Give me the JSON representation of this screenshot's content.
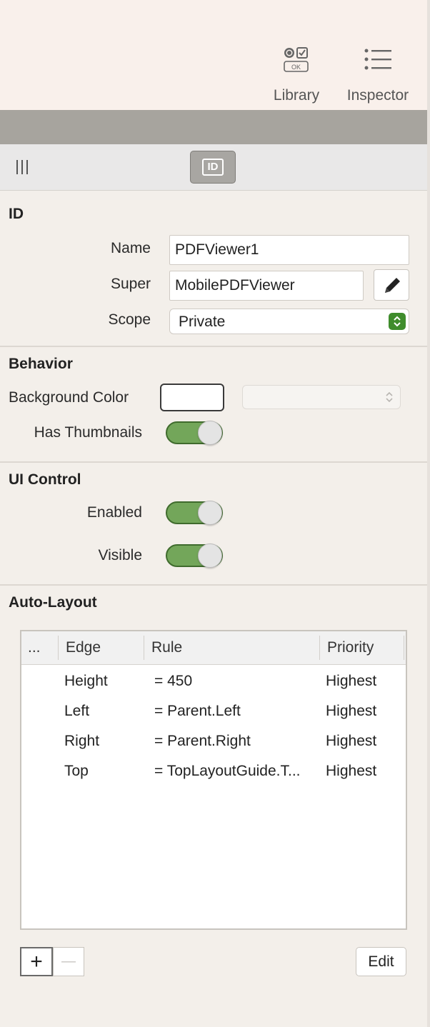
{
  "toolbar": {
    "library_label": "Library",
    "library_icon": "library-icon",
    "inspector_label": "Inspector",
    "inspector_icon": "list-icon"
  },
  "tabbar": {
    "handle_icon": "grip-icon",
    "id_tab_icon": "id-tab-icon",
    "id_tab_text": "ID"
  },
  "id_section": {
    "title": "ID",
    "name_label": "Name",
    "name_value": "PDFViewer1",
    "super_label": "Super",
    "super_value": "MobilePDFViewer",
    "scope_label": "Scope",
    "scope_value": "Private"
  },
  "behavior": {
    "title": "Behavior",
    "bg_color_label": "Background Color",
    "bg_color_value": "#ffffff",
    "thumbnails_label": "Has Thumbnails",
    "thumbnails_on": true
  },
  "ui_control": {
    "title": "UI Control",
    "enabled_label": "Enabled",
    "enabled_on": true,
    "visible_label": "Visible",
    "visible_on": true
  },
  "auto_layout": {
    "title": "Auto-Layout",
    "columns": [
      "...",
      "Edge",
      "Rule",
      "Priority"
    ],
    "rows": [
      {
        "edge": "Height",
        "rule": "=  450",
        "priority": "Highest"
      },
      {
        "edge": "Left",
        "rule": "= Parent.Left",
        "priority": "Highest"
      },
      {
        "edge": "Right",
        "rule": "= Parent.Right",
        "priority": "Highest"
      },
      {
        "edge": "Top",
        "rule": "= TopLayoutGuide.T...",
        "priority": "Highest"
      }
    ],
    "add_label": "+",
    "remove_label": "—",
    "edit_label": "Edit"
  },
  "colors": {
    "toggle_on": "#73a65a",
    "scope_stepper": "#3f8c2c",
    "panel_bg": "#f3efea"
  }
}
